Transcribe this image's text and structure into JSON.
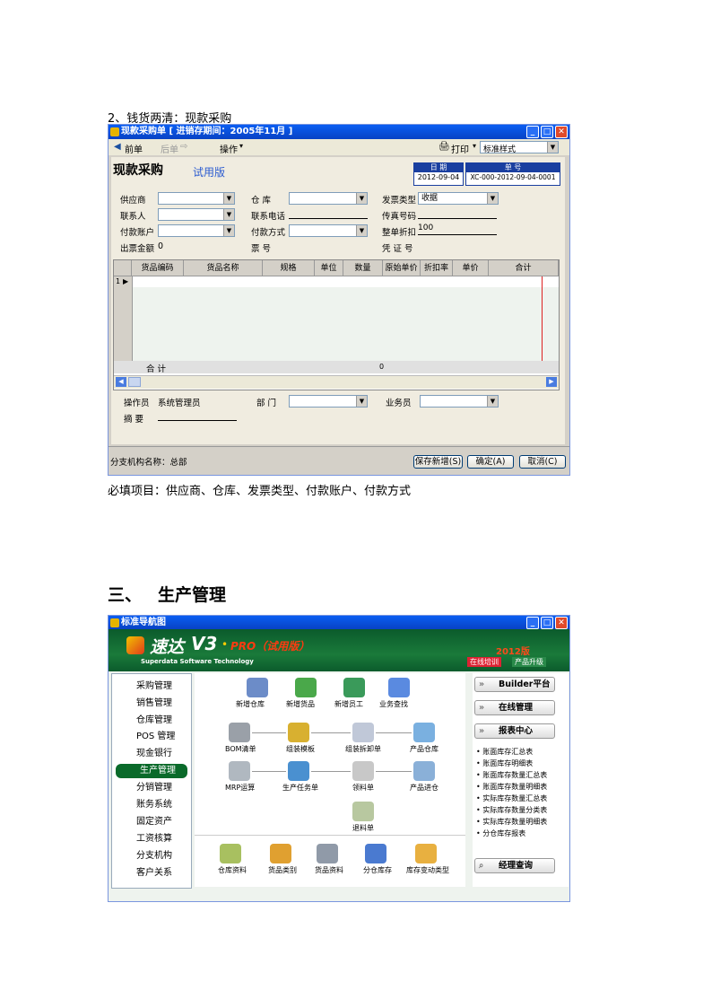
{
  "section1": {
    "heading": "2、钱货两清：现款采购",
    "footnote": "必填项目：供应商、仓库、发票类型、付款账户、付款方式"
  },
  "purchase_window": {
    "title": "现款采购单 [ 进销存期间：2005年11月 ]",
    "toolbar": {
      "prev": "前单",
      "next": "后单",
      "ops": "操作",
      "print": "打印",
      "style_select": "标准样式"
    },
    "form_title": "现款采购",
    "trial": "试用版",
    "date_label": "日 期",
    "date_value": "2012-09-04",
    "no_label": "单 号",
    "no_value": "XC-000-2012-09-04-0001",
    "fields": {
      "supplier": "供应商",
      "warehouse": "仓 库",
      "invoice_type": "发票类型",
      "invoice_type_value": "收据",
      "contact": "联系人",
      "phone": "联系电话",
      "fax": "传真号码",
      "account": "付款账户",
      "pay_method": "付款方式",
      "discount": "整单折扣",
      "discount_value": "100",
      "invoice_amount": "出票金额",
      "invoice_amount_value": "0",
      "ticket_no": "票 号",
      "voucher_no": "凭 证 号"
    },
    "grid_headers": [
      "货品编码",
      "货品名称",
      "规格",
      "单位",
      "数量",
      "原始单价",
      "折扣率",
      "单价",
      "合计"
    ],
    "first_row_marker": "1",
    "total_label": "合 计",
    "total_value": "0",
    "operator_label": "操作员",
    "operator_value": "系统管理员",
    "dept_label": "部 门",
    "salesman_label": "业务员",
    "summary_label": "摘 要",
    "branch_label": "分支机构名称：总部",
    "buttons": {
      "save_new": "保存新增(S)",
      "ok": "确定(A)",
      "cancel": "取消(C)"
    }
  },
  "section2": {
    "number": "三、",
    "title": "生产管理"
  },
  "nav_window": {
    "title": "标准导航图",
    "brand": "速达",
    "version": "V3",
    "edition": "PRO（试用版）",
    "company": "Superdata Software Technology",
    "year": "2012版",
    "online_training": "在线培训",
    "upgrade": "产品升级",
    "sidebar": [
      "采购管理",
      "销售管理",
      "仓库管理",
      "POS 管理",
      "现金银行",
      "生产管理",
      "分销管理",
      "账务系统",
      "固定资产",
      "工资核算",
      "分支机构",
      "客户关系"
    ],
    "active_index": 5,
    "top_icons": [
      "新增仓库",
      "新增货品",
      "新增员工",
      "业务查找"
    ],
    "flow_row1": [
      "BOM清单",
      "组装模板",
      "组装拆卸单",
      "产品仓库"
    ],
    "flow_row2": [
      "MRP运算",
      "生产任务单",
      "领料单",
      "产品进仓"
    ],
    "flow_row3": [
      "退料单"
    ],
    "bottom_icons": [
      "仓库资料",
      "货品类别",
      "货品资料",
      "分仓库存",
      "库存变动类型"
    ],
    "right_buttons": [
      "Builder平台",
      "在线管理",
      "报表中心"
    ],
    "reports": [
      "账面库存汇总表",
      "账面库存明细表",
      "账面库存数量汇总表",
      "账面库存数量明细表",
      "实际库存数量汇总表",
      "实际库存数量分类表",
      "实际库存数量明细表",
      "分仓库存报表"
    ],
    "manager_query": "经理查询"
  }
}
